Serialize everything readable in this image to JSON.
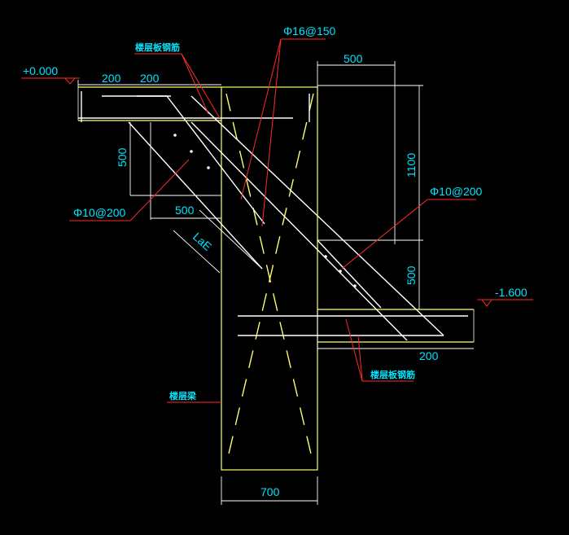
{
  "drawing": {
    "elevation_top": "+0.000",
    "elevation_bottom": "-1.600",
    "rebar_main": "Φ16@150",
    "rebar_left": "Φ10@200",
    "rebar_right": "Φ10@200",
    "label_slab_top": "楼层板钢筋",
    "label_slab_bottom": "楼层板钢筋",
    "label_beam": "楼层梁",
    "anchor_label": "LaE"
  },
  "dimensions": {
    "top_left_a": "200",
    "top_left_b": "200",
    "top_right_width": "500",
    "right_height_upper": "1100",
    "right_height_lower": "500",
    "left_height": "500",
    "left_width": "500",
    "bottom_slab": "200",
    "beam_width": "700"
  },
  "colors": {
    "background": "#000000",
    "dimension_text": "#00e5ff",
    "leader": "#ff2a2a",
    "beam_outline": "#ffff66",
    "rebar": "#ffffff"
  }
}
